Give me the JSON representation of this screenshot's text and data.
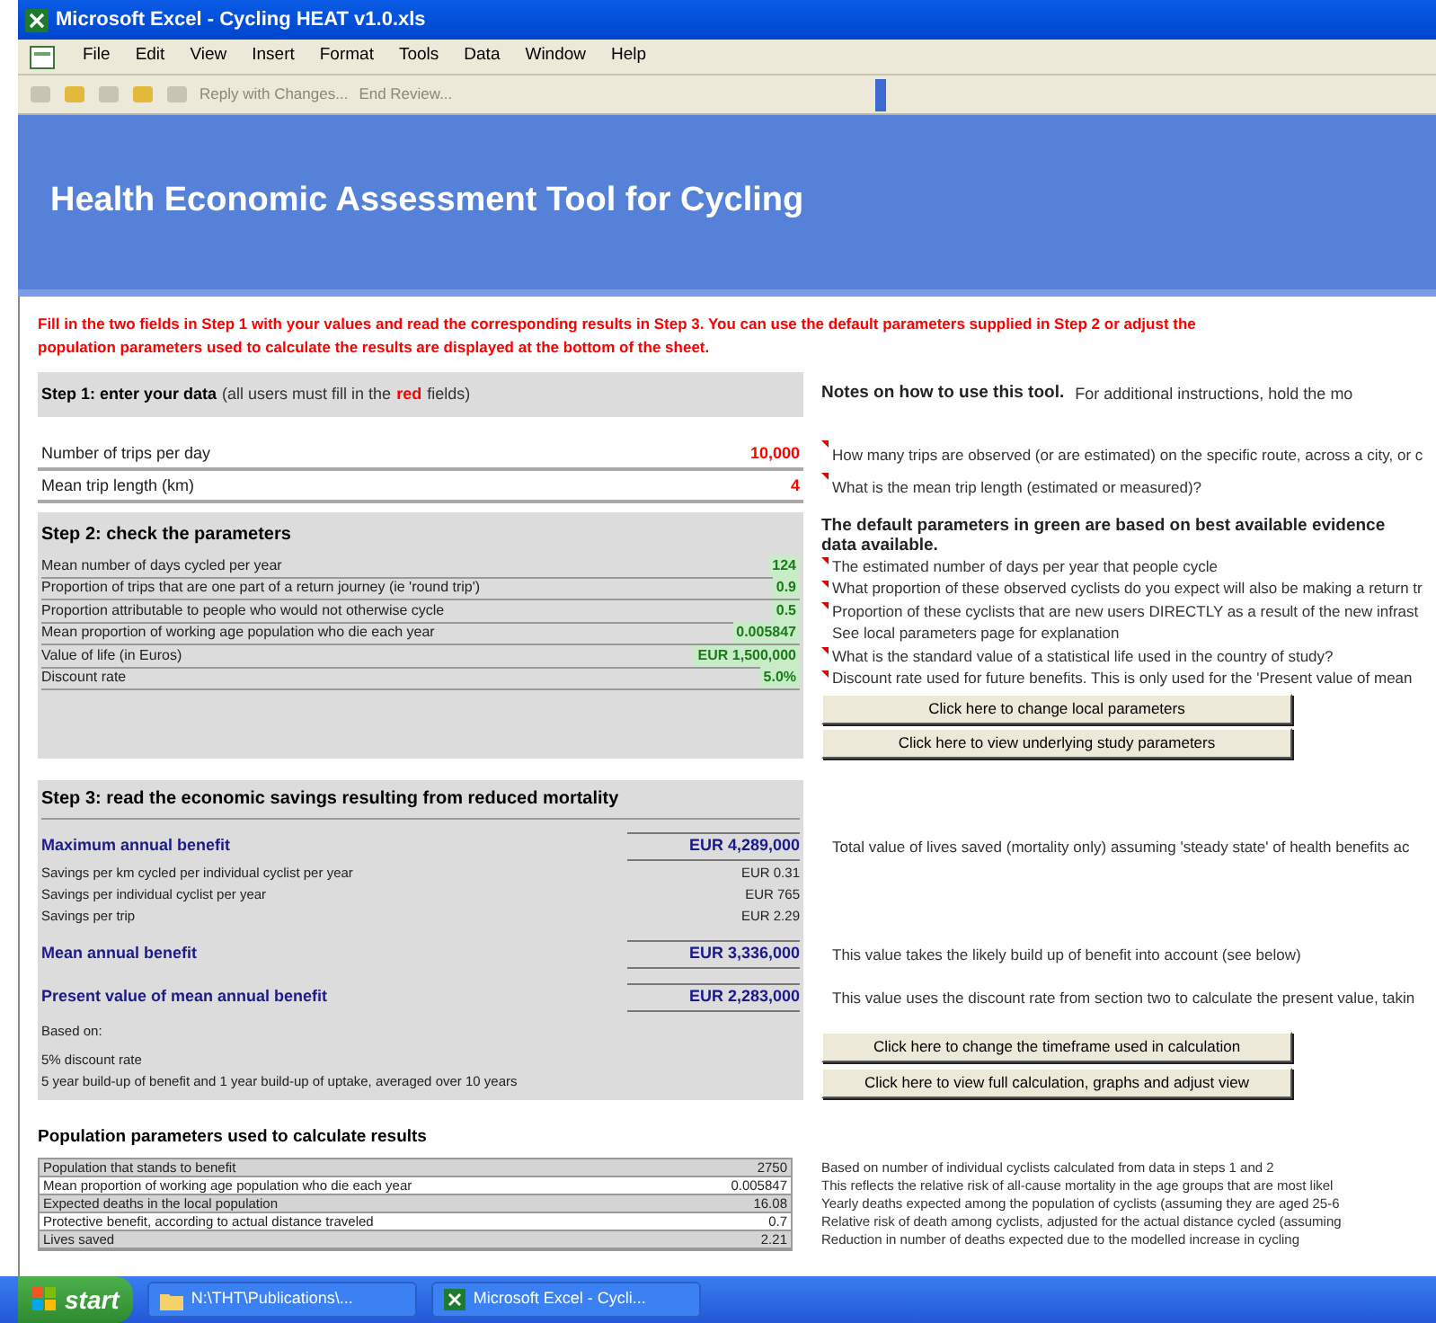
{
  "window": {
    "title": "Microsoft Excel - Cycling HEAT v1.0.xls"
  },
  "menu": [
    "File",
    "Edit",
    "View",
    "Insert",
    "Format",
    "Tools",
    "Data",
    "Window",
    "Help"
  ],
  "toolbar": {
    "items": [
      "Reply with Changes...",
      "End Review..."
    ]
  },
  "banner": {
    "title": "Health Economic Assessment Tool for Cycling"
  },
  "instructions": [
    "Fill in the two fields in Step 1 with your values and read the corresponding results in Step 3. You can use the default parameters supplied in Step 2 or adjust the",
    "population parameters used to calculate the results are displayed at the bottom of the sheet."
  ],
  "step1": {
    "title": "Step 1: enter your data",
    "note_parts": [
      {
        "text": "(all users must fill in the",
        "kind": "plain"
      },
      {
        "text": "red",
        "kind": "red"
      },
      {
        "text": "fields)",
        "kind": "plain"
      }
    ],
    "notes_title": "Notes on how to use this tool.",
    "notes_intro": "For additional instructions, hold the mo",
    "fields": [
      {
        "label": "Number of trips per day",
        "value": "10,000",
        "note": "How many trips are observed (or are estimated) on the specific route, across a city, or c",
        "flagged": true
      },
      {
        "label": "Mean trip length  (km)",
        "value": "4",
        "note": "What is the mean trip length (estimated or measured)?",
        "flagged": true
      }
    ]
  },
  "step2": {
    "title": "Step 2: check the parameters",
    "notes_title": "The default parameters in green are based on best available evidence",
    "notes_title_2": "data available.",
    "params": [
      {
        "label": "Mean number of days cycled per year",
        "value": "124",
        "note": "The estimated number of days per year that people cycle",
        "flagged": true
      },
      {
        "label": "Proportion of trips that are one part of a return journey (ie 'round trip')",
        "value": "0.9",
        "note": "What proportion of these observed cyclists do you expect will also be making a return tr",
        "flagged": true
      },
      {
        "label": "Proportion attributable to people who would not otherwise cycle",
        "value": "0.5",
        "note": "Proportion of these cyclists that are new users DIRECTLY as a result of the new infrast",
        "flagged": true
      },
      {
        "label": "Mean proportion of working age population who die each year",
        "value": "0.005847",
        "note": "See local parameters page for explanation",
        "flagged": false
      },
      {
        "label": "Value of life (in Euros)",
        "value": "EUR 1,500,000",
        "note": "What is the standard value of a statistical life used in the country of study?",
        "flagged": true
      },
      {
        "label": "Discount rate",
        "value": "5.0%",
        "note": "Discount rate used for future benefits.  This is only used for the 'Present value of mean",
        "flagged": true
      }
    ],
    "buttons": [
      "Click here to change local parameters",
      "Click here to view underlying study parameters"
    ]
  },
  "step3": {
    "title": "Step 3: read the economic savings resulting from reduced mortality",
    "rows": [
      {
        "kind": "main",
        "label": "Maximum annual benefit",
        "value": "EUR 4,289,000",
        "note": "Total value of lives saved (mortality only) assuming 'steady state' of health benefits ac"
      },
      {
        "kind": "sub",
        "label": "Savings per km cycled per individual cyclist per year",
        "value": "EUR 0.31"
      },
      {
        "kind": "sub",
        "label": "Savings per individual cyclist per year",
        "value": "EUR 765"
      },
      {
        "kind": "sub",
        "label": "Savings per trip",
        "value": "EUR 2.29"
      },
      {
        "kind": "main",
        "label": "Mean annual benefit",
        "value": "EUR 3,336,000",
        "note": "This value takes the likely build up of benefit into account (see below)"
      },
      {
        "kind": "main",
        "label": "Present value of mean annual benefit",
        "value": "EUR 2,283,000",
        "note": "This value uses the discount rate from section two to calculate the present value, takin"
      }
    ],
    "basis": [
      "Based on:",
      "5% discount rate",
      "5 year build-up of benefit and 1 year build-up of uptake, averaged over 10 years"
    ],
    "buttons": [
      "Click here to change the timeframe used in calculation",
      "Click here to view full calculation, graphs and adjust view"
    ]
  },
  "population": {
    "title": "Population parameters used to calculate results",
    "rows": [
      {
        "label": "Population that stands to benefit",
        "value": "2750",
        "note": "Based on number of individual cyclists calculated from data in steps 1 and 2"
      },
      {
        "label": "Mean proportion of working age population who die each year",
        "value": "0.005847",
        "note": "This reflects the relative risk of all-cause mortality in the age groups that are most likel"
      },
      {
        "label": "Expected deaths in the local population",
        "value": "16.08",
        "note": "Yearly deaths expected among the population of cyclists (assuming they are aged 25-6"
      },
      {
        "label": "Protective benefit, according to actual distance traveled",
        "value": "0.7",
        "note": "Relative risk of death among cyclists, adjusted for the actual distance cycled (assuming"
      },
      {
        "label": "Lives saved",
        "value": "2.21",
        "note": "Reduction in number of deaths expected due to the modelled increase in cycling"
      }
    ]
  },
  "taskbar": {
    "start": "start",
    "tasks": [
      {
        "label": "N:\\THT\\Publications\\...",
        "kind": "folder"
      },
      {
        "label": "Microsoft Excel - Cycli...",
        "kind": "excel"
      }
    ]
  }
}
